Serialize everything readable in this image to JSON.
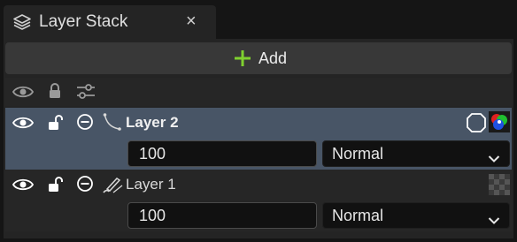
{
  "tab": {
    "title": "Layer Stack",
    "close_glyph": "×",
    "icon": "layers-icon"
  },
  "toolbar": {
    "add_label": "Add",
    "add_icon": "plus-icon"
  },
  "header_icons": [
    "eye-icon",
    "lock-icon",
    "adjustments-icon"
  ],
  "layers": [
    {
      "name": "Layer 2",
      "opacity": "100",
      "blend_mode": "Normal",
      "selected": true,
      "type_icon": "paint-curve-icon",
      "extra_icons": [
        "mask-circle-icon",
        "color-channels-icon"
      ]
    },
    {
      "name": "Layer 1",
      "opacity": "100",
      "blend_mode": "Normal",
      "selected": false,
      "type_icon": "brush-icon",
      "extra_icons": [
        "checker-thumbnail-icon"
      ]
    }
  ],
  "colors": {
    "accent_add": "#7fd12f",
    "selected_row": "#485566",
    "panel": "#242424"
  }
}
